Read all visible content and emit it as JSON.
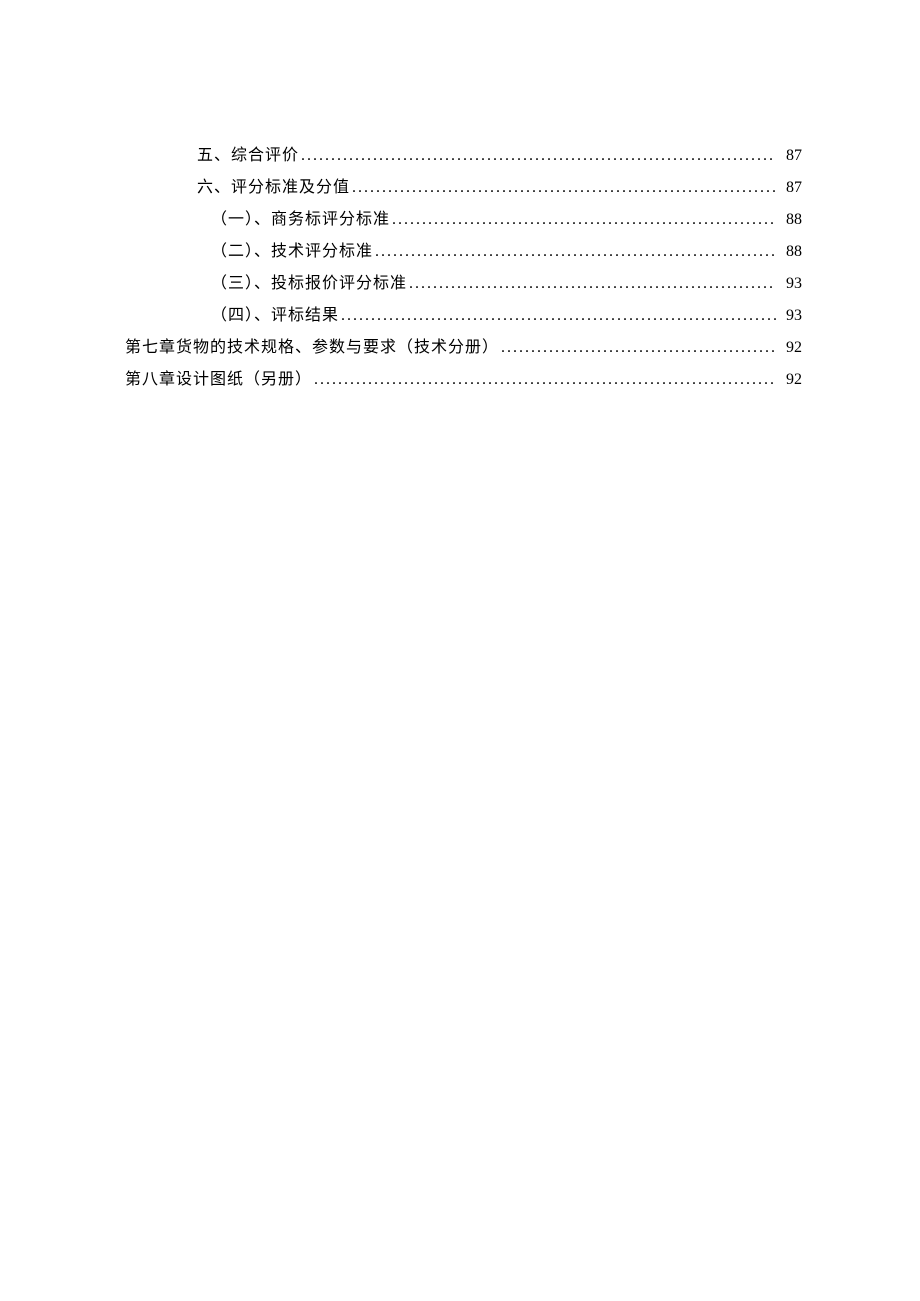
{
  "toc": {
    "entries": [
      {
        "level": 2,
        "label": "五、综合评价",
        "page": "87"
      },
      {
        "level": 2,
        "label": "六、评分标准及分值",
        "page": "87"
      },
      {
        "level": 3,
        "label": "（一）、商务标评分标准",
        "page": "88"
      },
      {
        "level": 3,
        "label": "（二）、技术评分标准",
        "page": "88"
      },
      {
        "level": 3,
        "label": "（三）、投标报价评分标准",
        "page": "93"
      },
      {
        "level": 3,
        "label": "（四）、评标结果",
        "page": "93"
      },
      {
        "level": 1,
        "label": "第七章货物的技术规格、参数与要求（技术分册）",
        "page": "92"
      },
      {
        "level": 1,
        "label": "第八章设计图纸（另册）",
        "page": "92"
      }
    ]
  }
}
